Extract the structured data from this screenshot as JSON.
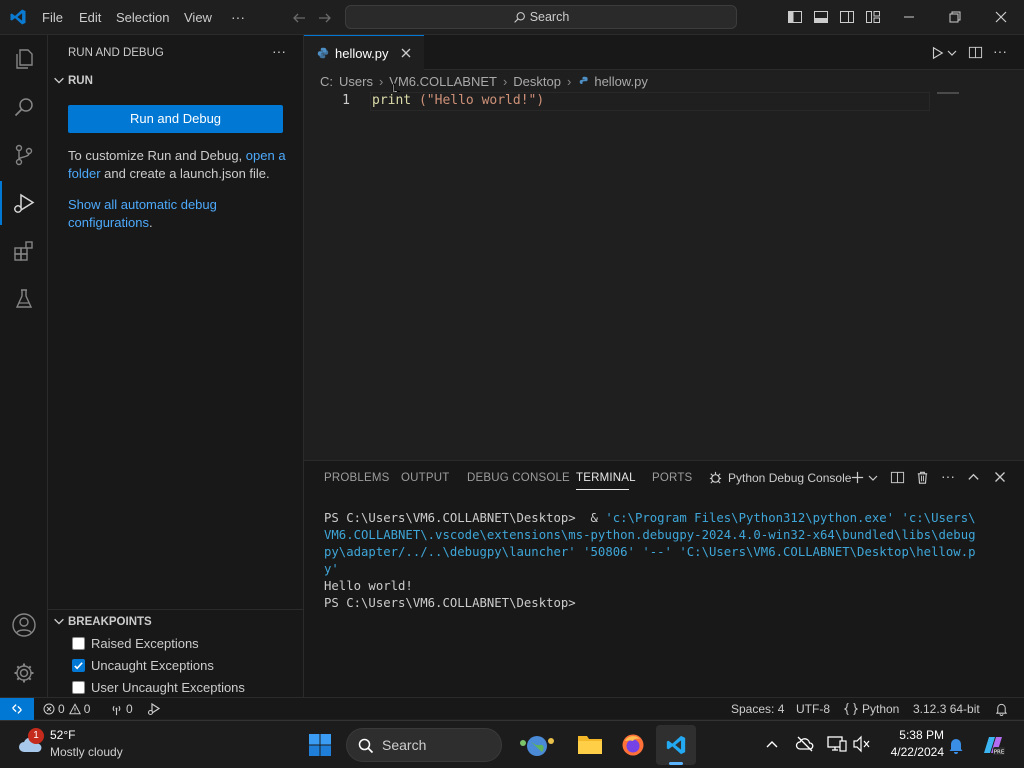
{
  "menu": {
    "file": "File",
    "edit": "Edit",
    "selection": "Selection",
    "view": "View",
    "more": "···"
  },
  "search": {
    "label": "Search"
  },
  "sidebar": {
    "title": "RUN AND DEBUG",
    "run_section": "RUN",
    "run_button": "Run and Debug",
    "customize_text": "To customize Run and Debug, ",
    "open_link_1": "open a",
    "open_link_2": "folder",
    "customize_rest": " and create a launch.json file.",
    "show_link_1": "Show all automatic debug",
    "show_link_2": "configurations",
    "period": ".",
    "breakpoints_title": "BREAKPOINTS",
    "breakpoints": [
      {
        "label": "Raised Exceptions",
        "checked": false
      },
      {
        "label": "Uncaught Exceptions",
        "checked": true
      },
      {
        "label": "User Uncaught Exceptions",
        "checked": false
      }
    ]
  },
  "editor": {
    "tab_name": "hellow.py",
    "breadcrumb": [
      "C:",
      "Users",
      "VM6.COLLABNET",
      "Desktop",
      "hellow.py"
    ],
    "line_number": "1",
    "code_fn": "print",
    "code_args": " (\"Hello world!\")"
  },
  "panel": {
    "tabs": [
      "PROBLEMS",
      "OUTPUT",
      "DEBUG CONSOLE",
      "TERMINAL",
      "PORTS"
    ],
    "active_tab": "TERMINAL",
    "debug_console_label": "Python Debug Console",
    "terminal": {
      "prompt1": "PS C:\\Users\\VM6.COLLABNET\\Desktop>  & ",
      "cmd_l1": "'c:\\Program Files\\Python312\\python.exe' 'c:\\Users\\",
      "cmd_l2": "VM6.COLLABNET\\.vscode\\extensions\\ms-python.debugpy-2024.4.0-win32-x64\\bundled\\libs\\debug",
      "cmd_l3": "py\\adapter/../..\\debugpy\\launcher' '50806' '--' 'C:\\Users\\VM6.COLLABNET\\Desktop\\hellow.p",
      "cmd_l4": "y'",
      "output": "Hello world!",
      "prompt2": "PS C:\\Users\\VM6.COLLABNET\\Desktop>"
    }
  },
  "statusbar": {
    "errors": "0",
    "warnings": "0",
    "ports": "0",
    "spaces": "Spaces: 4",
    "encoding": "UTF-8",
    "language": "Python",
    "interpreter": "3.12.3 64-bit"
  },
  "taskbar": {
    "weather_temp": "52°F",
    "weather_desc": "Mostly cloudy",
    "weather_badge": "1",
    "search_label": "Search",
    "time": "5:38 PM",
    "date": "4/22/2024"
  },
  "colors": {
    "accent": "#0078d4",
    "link": "#4daafc",
    "string": "#ce9178",
    "function": "#dcdcaa"
  }
}
